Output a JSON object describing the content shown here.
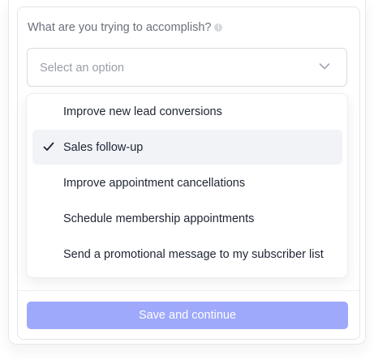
{
  "form": {
    "question": "What are you trying to accomplish?",
    "info_icon": "info-icon",
    "select": {
      "placeholder": "Select an option",
      "icon": "chevron-down-icon"
    }
  },
  "dropdown": {
    "options": [
      {
        "label": "Improve new lead conversions",
        "selected": false
      },
      {
        "label": "Sales follow-up",
        "selected": true
      },
      {
        "label": "Improve appointment cancellations",
        "selected": false
      },
      {
        "label": "Schedule membership appointments",
        "selected": false
      },
      {
        "label": "Send a promotional message to my subscriber list",
        "selected": false
      }
    ],
    "selected_icon": "check-icon"
  },
  "footer": {
    "save_label": "Save and continue"
  },
  "colors": {
    "accent_button": "#9ea9fb",
    "selected_row": "#f1f3f7",
    "text_primary": "#1f2433",
    "text_muted": "#6b6f7a"
  }
}
